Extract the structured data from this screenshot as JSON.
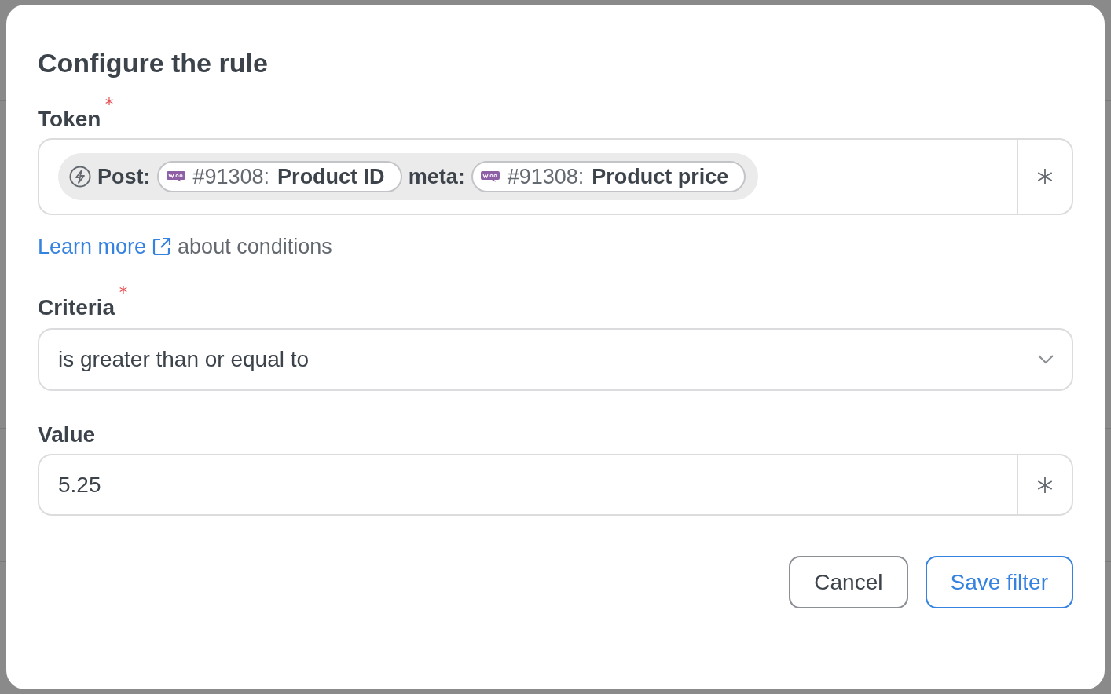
{
  "dialog": {
    "title": "Configure the rule"
  },
  "token": {
    "label": "Token",
    "required": true,
    "prefix": "Post:",
    "parts": [
      {
        "kind": "token",
        "id": "#91308:",
        "name": "Product ID"
      },
      {
        "kind": "text",
        "text": "meta:"
      },
      {
        "kind": "token",
        "id": "#91308:",
        "name": "Product price"
      }
    ]
  },
  "help": {
    "link": "Learn more",
    "text": "about conditions"
  },
  "criteria": {
    "label": "Criteria",
    "required": true,
    "value": "is greater than or equal to"
  },
  "value_field": {
    "label": "Value",
    "value": "5.25"
  },
  "buttons": [
    {
      "label": "Cancel",
      "kind": "secondary"
    },
    {
      "label": "Save filter",
      "kind": "primary"
    }
  ]
}
